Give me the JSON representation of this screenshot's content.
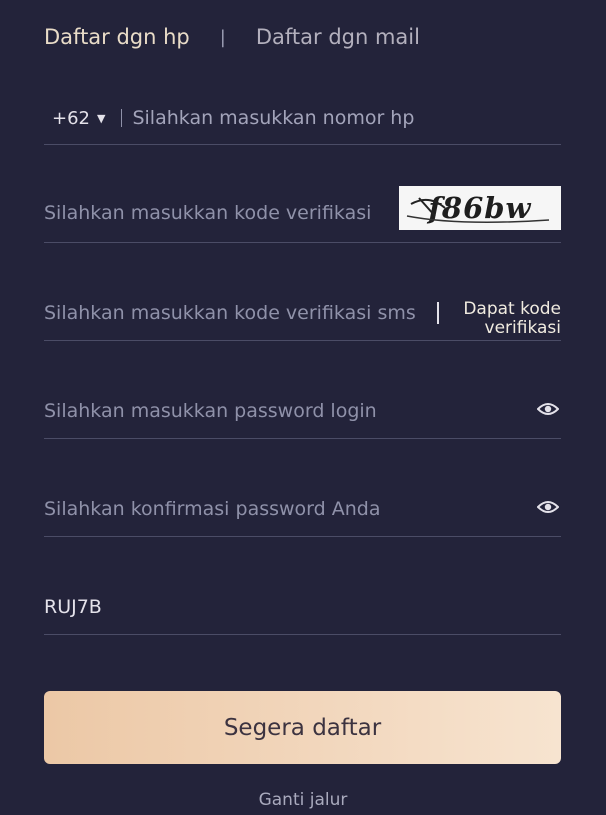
{
  "tabs": {
    "phone": "Daftar dgn hp",
    "separator": "|",
    "email": "Daftar dgn mail"
  },
  "phone": {
    "country_code": "+62",
    "placeholder": "Silahkan masukkan nomor hp"
  },
  "captcha": {
    "placeholder": "Silahkan masukkan kode verifikasi",
    "image_text": "f86bw"
  },
  "sms": {
    "placeholder": "Silahkan masukkan kode verifikasi sms",
    "button_line1": "Dapat kode",
    "button_line2": "verifikasi"
  },
  "password": {
    "placeholder": "Silahkan masukkan password login",
    "icon": "eye-icon"
  },
  "confirm_password": {
    "placeholder": "Silahkan konfirmasi password Anda",
    "icon": "eye-icon"
  },
  "referral": {
    "value": "RUJ7B"
  },
  "submit_label": "Segera daftar",
  "switch_label": "Ganti jalur",
  "colors": {
    "background": "#23233a",
    "accent": "#ecc8a6",
    "divider": "#4b4c66"
  }
}
